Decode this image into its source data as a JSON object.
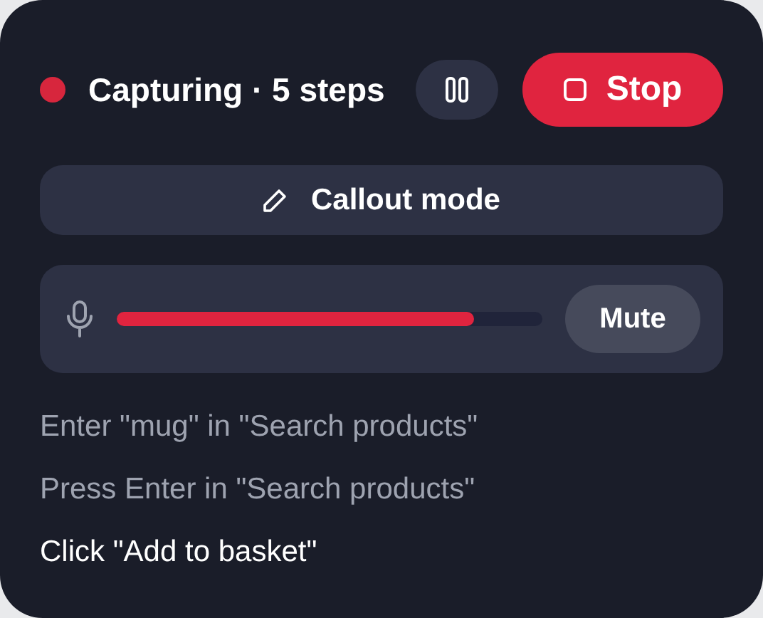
{
  "status": {
    "title": "Capturing · 5 steps",
    "recording": true
  },
  "stop_button": {
    "label": "Stop"
  },
  "callout_button": {
    "label": "Callout mode"
  },
  "microphone": {
    "level": 0.84,
    "mute_label": "Mute",
    "muted": false
  },
  "steps": [
    {
      "text": "Enter \"mug\" in \"Search products\"",
      "current": false
    },
    {
      "text": "Press Enter in \"Search products\"",
      "current": false
    },
    {
      "text": "Click \"Add to basket\"",
      "current": true
    }
  ]
}
